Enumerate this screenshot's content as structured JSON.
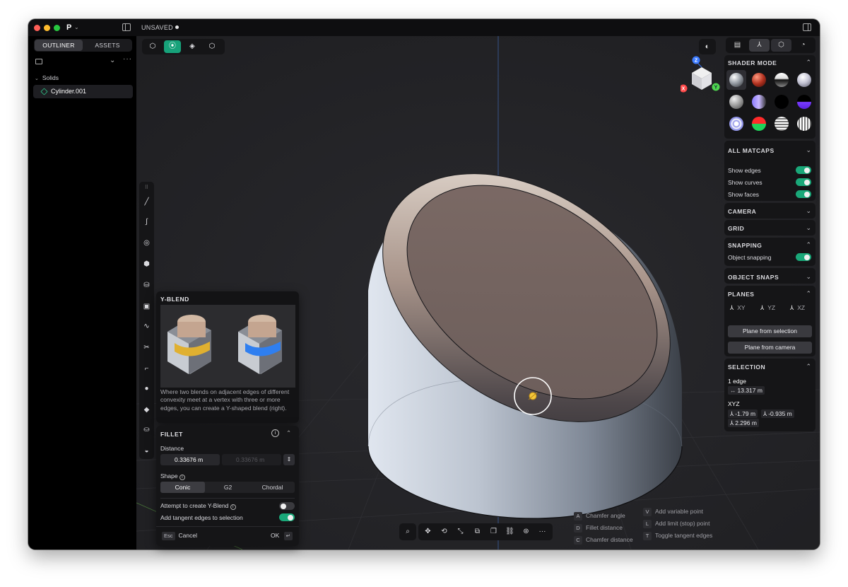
{
  "titlebar": {
    "doc_status": "UNSAVED"
  },
  "sidebar": {
    "tabs": [
      {
        "label": "OUTLINER",
        "active": true
      },
      {
        "label": "ASSETS",
        "active": false
      }
    ],
    "group_label": "Solids",
    "items": [
      {
        "label": "Cylinder.001"
      }
    ]
  },
  "viewport": {
    "nav_cube": {
      "z": "Z",
      "x": "X",
      "y": "Y"
    }
  },
  "yblend": {
    "title": "Y-BLEND",
    "description": "Where two blends on adjacent edges of different convexity meet at a vertex with three or more edges, you can create a Y-shaped blend (right)."
  },
  "fillet": {
    "title": "FILLET",
    "distance_label": "Distance",
    "distance_value": "0.33676 m",
    "distance_value_2": "0.33676 m",
    "shape_label": "Shape",
    "shape_options": [
      {
        "label": "Conic",
        "active": true
      },
      {
        "label": "G2",
        "active": false
      },
      {
        "label": "Chordal",
        "active": false
      }
    ],
    "y_blend_label": "Attempt to create Y-Blend",
    "y_blend_on": false,
    "tangent_label": "Add tangent edges to selection",
    "tangent_on": true,
    "cancel_key": "Esc",
    "cancel_label": "Cancel",
    "ok_label": "OK",
    "ok_key": "↵"
  },
  "hints": {
    "col1": [
      {
        "key": "A",
        "label": "Chamfer angle"
      },
      {
        "key": "D",
        "label": "Fillet distance"
      },
      {
        "key": "C",
        "label": "Chamfer distance"
      }
    ],
    "col2": [
      {
        "key": "V",
        "label": "Add variable point"
      },
      {
        "key": "L",
        "label": "Add limit (stop) point"
      },
      {
        "key": "T",
        "label": "Toggle tangent edges"
      }
    ]
  },
  "right_panel": {
    "shader_mode_title": "SHADER MODE",
    "all_matcaps_title": "ALL MATCAPS",
    "show_edges": "Show edges",
    "show_curves": "Show curves",
    "show_faces": "Show faces",
    "camera_title": "CAMERA",
    "grid_title": "GRID",
    "snapping_title": "SNAPPING",
    "object_snapping": "Object snapping",
    "object_snaps_title": "OBJECT SNAPS",
    "planes_title": "PLANES",
    "planes": [
      "XY",
      "YZ",
      "XZ"
    ],
    "plane_from_selection": "Plane from selection",
    "plane_from_camera": "Plane from camera",
    "selection_title": "SELECTION",
    "selection_count": "1 edge",
    "selection_length": "13.317 m",
    "xyz_label": "XYZ",
    "xyz_x": "-1.79 m",
    "xyz_y": "-0.935 m",
    "xyz_z": "2.296 m"
  },
  "colors": {
    "accent_green": "#1aa879",
    "background": "#232326",
    "panel": "#151517"
  }
}
